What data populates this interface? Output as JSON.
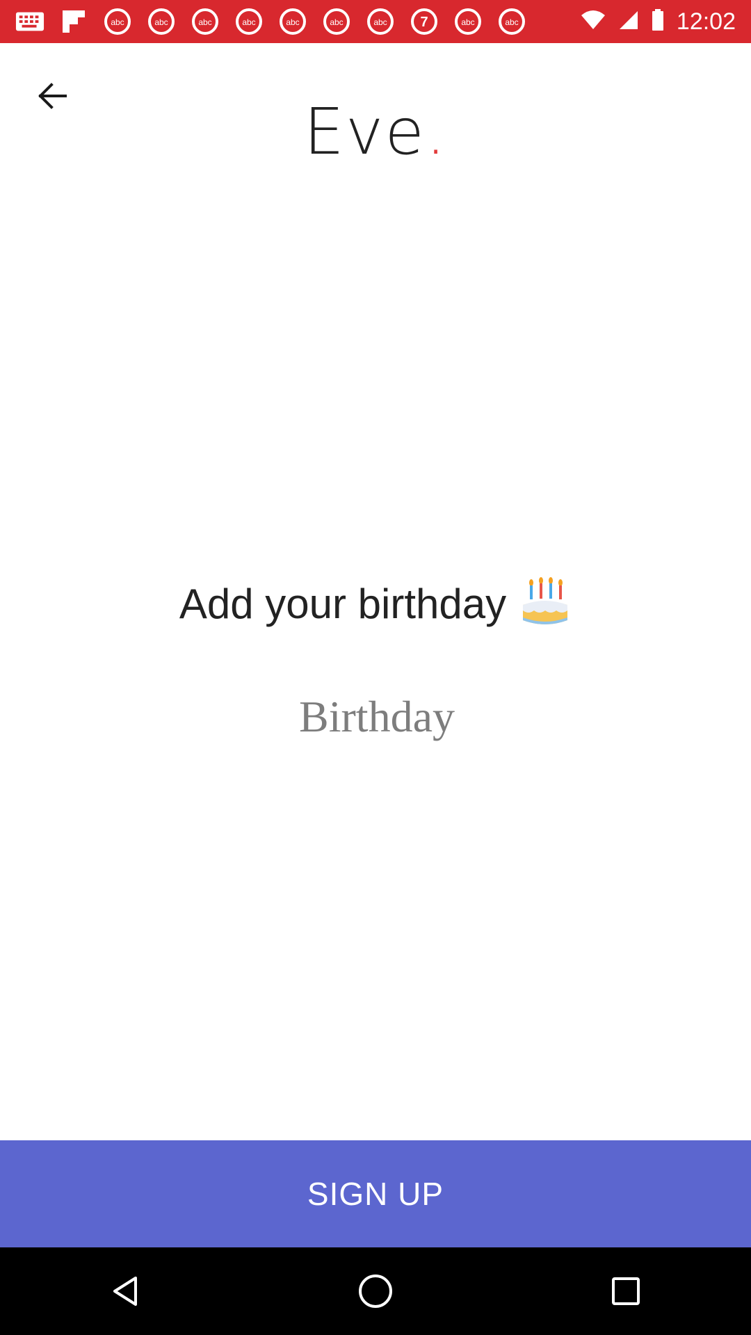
{
  "status_bar": {
    "time": "12:02",
    "notification_icons": [
      "keyboard-icon",
      "flipboard-icon",
      "abc-news-icon",
      "abc-news-icon",
      "abc-news-icon",
      "abc-news-icon",
      "abc-news-icon",
      "abc-news-icon",
      "abc-news-icon",
      "abc7-icon",
      "abc-news-icon",
      "abc-news-icon"
    ],
    "background_color": "#d8282e"
  },
  "header": {
    "back_icon": "arrow-back-icon",
    "logo_text": "Eve",
    "logo_dot": ".",
    "logo_dot_color": "#e23b3b"
  },
  "main": {
    "heading": "Add your birthday",
    "heading_icon": "birthday-cake-icon",
    "birthday_field": {
      "placeholder": "Birthday",
      "value": ""
    }
  },
  "footer": {
    "signup_label": "SIGN UP",
    "signup_color": "#5c66cf"
  },
  "nav_bar": {
    "back_icon": "nav-back-icon",
    "home_icon": "nav-home-icon",
    "recents_icon": "nav-recents-icon"
  }
}
